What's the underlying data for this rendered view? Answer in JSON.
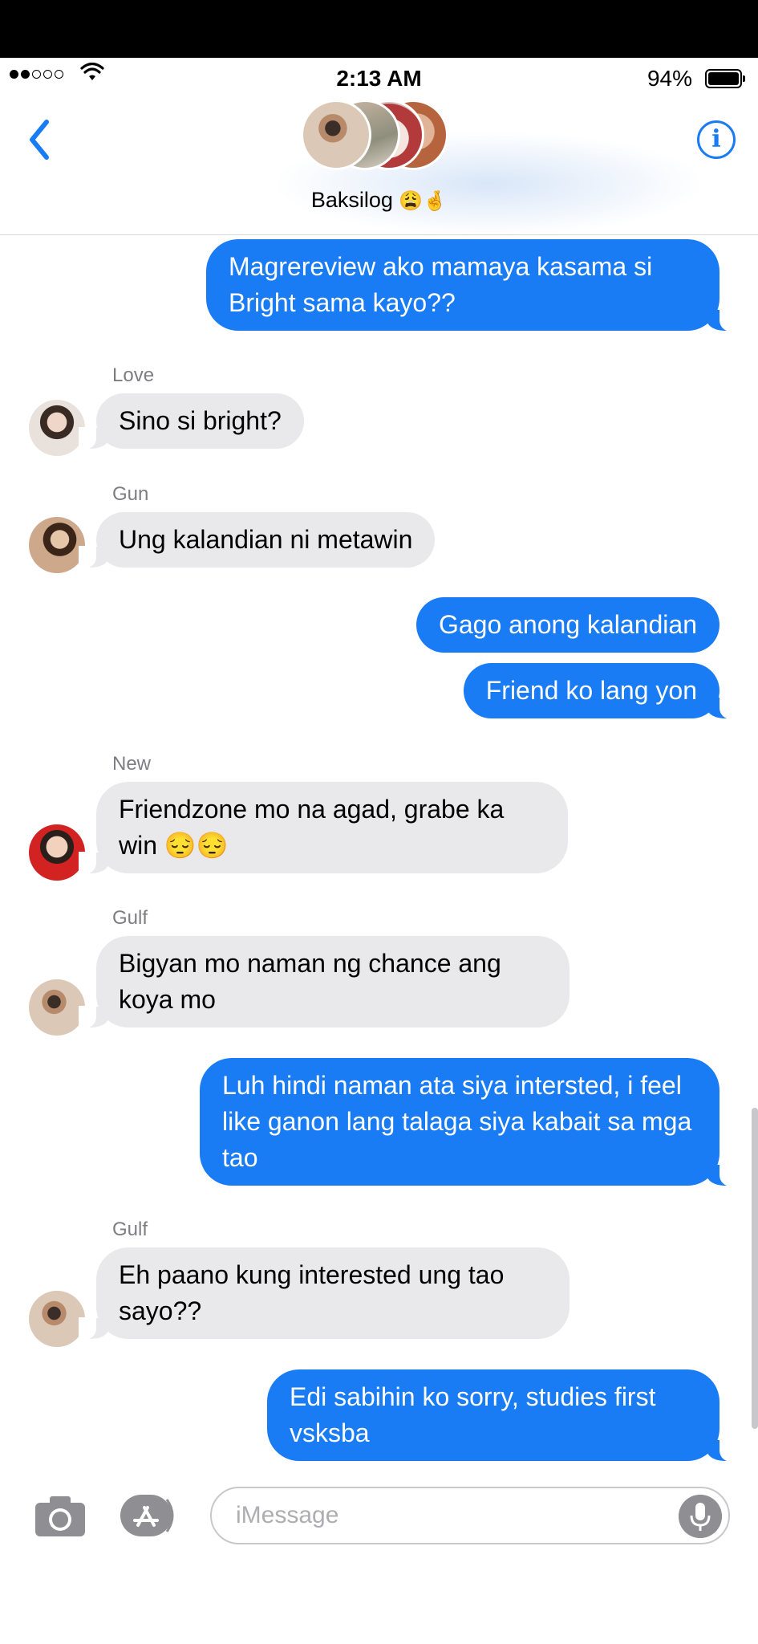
{
  "status_bar": {
    "signal_bars_filled": 2,
    "signal_bars_total": 5,
    "time": "2:13 AM",
    "battery_percent": "94%",
    "battery_level": 0.94
  },
  "header": {
    "group_name": "Baksilog",
    "group_emoji": "😩🤞",
    "back_icon": "chevron-left-icon",
    "info_icon": "info-icon",
    "info_glyph": "i"
  },
  "messages": [
    {
      "type": "sent",
      "text": "Magrereview ako mamaya kasama si Bright sama kayo??"
    },
    {
      "type": "received",
      "sender": "Love",
      "text": "Sino si bright?"
    },
    {
      "type": "received",
      "sender": "Gun",
      "text": "Ung kalandian ni metawin"
    },
    {
      "type": "sent",
      "text": "Gago anong kalandian"
    },
    {
      "type": "sent",
      "text": "Friend ko lang yon"
    },
    {
      "type": "received",
      "sender": "New",
      "text": "Friendzone mo na agad, grabe ka win 😔😔"
    },
    {
      "type": "received",
      "sender": "Gulf",
      "text": "Bigyan mo naman ng chance ang koya mo"
    },
    {
      "type": "sent",
      "text": "Luh hindi naman ata siya intersted, i feel like ganon lang talaga siya kabait sa mga tao"
    },
    {
      "type": "received",
      "sender": "Gulf",
      "text": "Eh paano kung interested ung tao sayo??"
    },
    {
      "type": "sent",
      "text": "Edi sabihin ko sorry, studies first vsksba"
    }
  ],
  "input_bar": {
    "placeholder": "iMessage",
    "camera_icon": "camera-icon",
    "appstore_icon": "app-store-icon",
    "mic_icon": "microphone-icon"
  },
  "colors": {
    "sent_bubble": "#1a7cf5",
    "received_bubble": "#e9e9eb",
    "accent": "#1a7cf5"
  }
}
